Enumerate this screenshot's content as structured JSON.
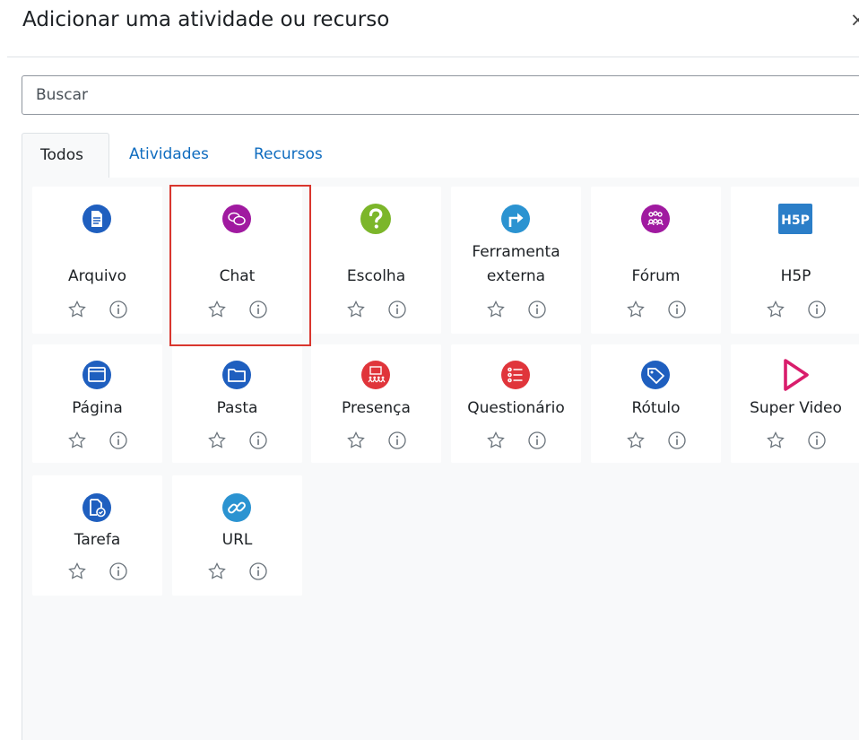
{
  "dialog": {
    "title": "Adicionar uma atividade ou recurso",
    "close_label": "×"
  },
  "search": {
    "placeholder": "Buscar"
  },
  "tabs": [
    {
      "label": "Todos",
      "active": true
    },
    {
      "label": "Atividades",
      "active": false
    },
    {
      "label": "Recursos",
      "active": false
    }
  ],
  "modules": [
    {
      "name": "Arquivo",
      "icon": "file-icon",
      "color": "#1f5fbf"
    },
    {
      "name": "Chat",
      "icon": "chat-icon",
      "color": "#a01aa0"
    },
    {
      "name": "Escolha",
      "icon": "question-icon",
      "color": "#7cb62a"
    },
    {
      "name_line1": "Ferramenta",
      "name_line2": "externa",
      "icon": "external-tool-icon",
      "color": "#2b93d1"
    },
    {
      "name": "Fórum",
      "icon": "forum-icon",
      "color": "#a01aa0"
    },
    {
      "name": "H5P",
      "icon": "h5p-icon",
      "color": "#2b7ec8"
    },
    {
      "name": "Página",
      "icon": "page-icon",
      "color": "#1f5fbf"
    },
    {
      "name": "Pasta",
      "icon": "folder-icon",
      "color": "#1f5fbf"
    },
    {
      "name": "Presença",
      "icon": "attendance-icon",
      "color": "#e0353b"
    },
    {
      "name": "Questionário",
      "icon": "quiz-icon",
      "color": "#e0353b"
    },
    {
      "name": "Rótulo",
      "icon": "label-icon",
      "color": "#1f5fbf"
    },
    {
      "name": "Super Video",
      "icon": "super-video-icon",
      "color": "#d91d6c"
    },
    {
      "name": "Tarefa",
      "icon": "assignment-icon",
      "color": "#1f5fbf"
    },
    {
      "name": "URL",
      "icon": "url-icon",
      "color": "#2b93d1"
    }
  ],
  "selected_module": "Chat"
}
